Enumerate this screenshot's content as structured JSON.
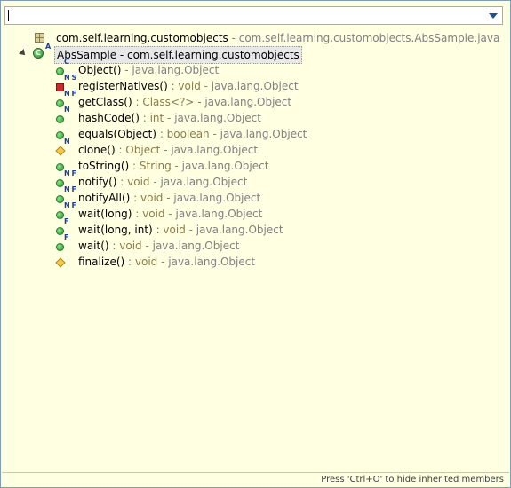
{
  "filter": {
    "value": ""
  },
  "tree": {
    "package": {
      "name": "com.self.learning.customobjects",
      "detail": " - com.self.learning.customobjects.AbsSample.java"
    },
    "class": {
      "modifier": "A",
      "name": "AbsSample - com.self.learning.customobjects"
    },
    "members": [
      {
        "icon": "public-method",
        "mod": "C",
        "name": "Object()",
        "ret": "",
        "owner": " - java.lang.Object"
      },
      {
        "icon": "private-method",
        "mod": "N S",
        "name": "registerNatives()",
        "ret": " : void",
        "owner": " - java.lang.Object"
      },
      {
        "icon": "public-method",
        "mod": "N F",
        "name": "getClass()",
        "ret": " : Class<?>",
        "owner": " - java.lang.Object"
      },
      {
        "icon": "public-method",
        "mod": "N",
        "name": "hashCode()",
        "ret": " : int",
        "owner": " - java.lang.Object"
      },
      {
        "icon": "public-method",
        "mod": "",
        "name": "equals(Object)",
        "ret": " : boolean",
        "owner": " - java.lang.Object"
      },
      {
        "icon": "protected-method",
        "mod": "N",
        "name": "clone()",
        "ret": " : Object",
        "owner": " - java.lang.Object"
      },
      {
        "icon": "public-method",
        "mod": "",
        "name": "toString()",
        "ret": " : String",
        "owner": " - java.lang.Object"
      },
      {
        "icon": "public-method",
        "mod": "N F",
        "name": "notify()",
        "ret": " : void",
        "owner": " - java.lang.Object"
      },
      {
        "icon": "public-method",
        "mod": "N F",
        "name": "notifyAll()",
        "ret": " : void",
        "owner": " - java.lang.Object"
      },
      {
        "icon": "public-method",
        "mod": "N F",
        "name": "wait(long)",
        "ret": " : void",
        "owner": " - java.lang.Object"
      },
      {
        "icon": "public-method",
        "mod": "F",
        "name": "wait(long, int)",
        "ret": " : void",
        "owner": " - java.lang.Object"
      },
      {
        "icon": "public-method",
        "mod": "F",
        "name": "wait()",
        "ret": " : void",
        "owner": " - java.lang.Object"
      },
      {
        "icon": "protected-method",
        "mod": "",
        "name": "finalize()",
        "ret": " : void",
        "owner": " - java.lang.Object"
      }
    ]
  },
  "status": {
    "hint": "Press 'Ctrl+O' to hide inherited members"
  }
}
